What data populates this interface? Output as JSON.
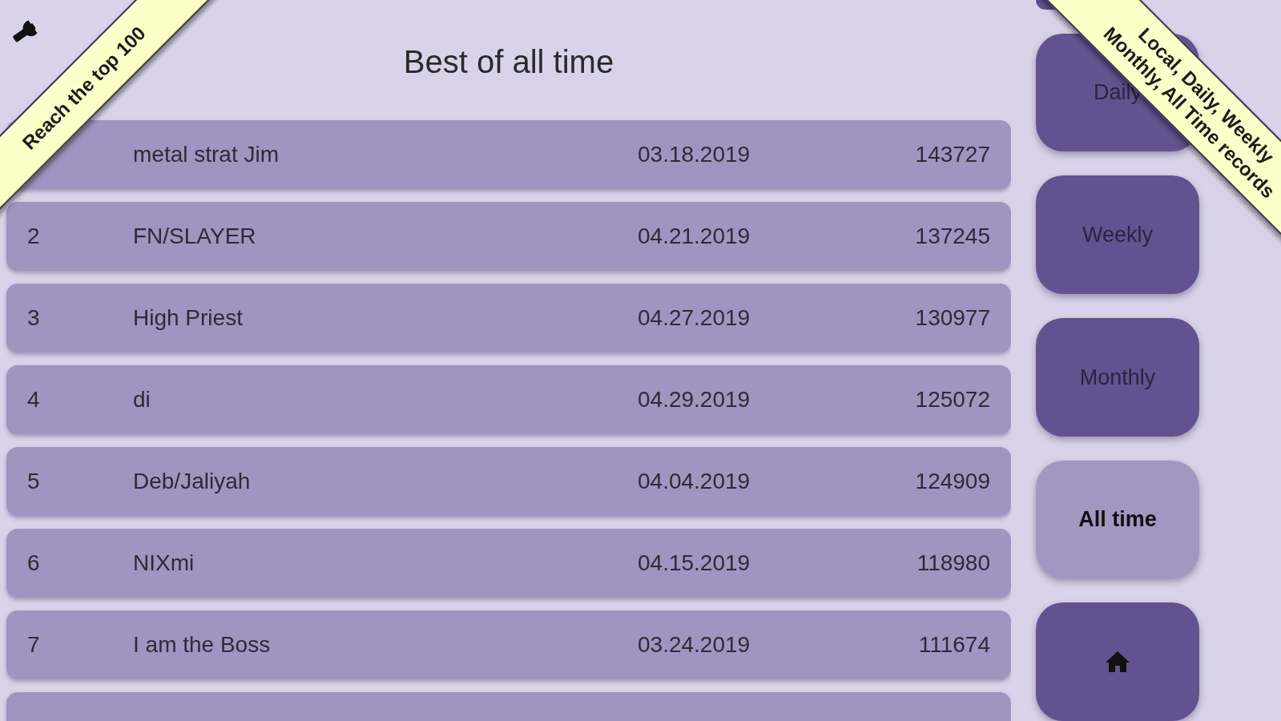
{
  "title": "Best of all time",
  "rows": [
    {
      "name": "metal strat Jim",
      "date": "03.18.2019",
      "score": "143727"
    },
    {
      "rank": "2",
      "name": "FN/SLAYER",
      "date": "04.21.2019",
      "score": "137245"
    },
    {
      "rank": "3",
      "name": "High Priest",
      "date": "04.27.2019",
      "score": "130977"
    },
    {
      "rank": "4",
      "name": "di",
      "date": "04.29.2019",
      "score": "125072"
    },
    {
      "rank": "5",
      "name": "Deb/Jaliyah",
      "date": "04.04.2019",
      "score": "124909"
    },
    {
      "rank": "6",
      "name": "NIXmi",
      "date": "04.15.2019",
      "score": "118980"
    },
    {
      "rank": "7",
      "name": "I am the Boss",
      "date": "03.24.2019",
      "score": "111674"
    },
    {}
  ],
  "buttons": [
    {
      "kind": "cut"
    },
    {
      "kind": "tab",
      "label": "Daily",
      "selected": false
    },
    {
      "kind": "tab",
      "label": "Weekly",
      "selected": false
    },
    {
      "kind": "tab",
      "label": "Monthly",
      "selected": false
    },
    {
      "kind": "tab",
      "label": "All time",
      "selected": true
    },
    {
      "kind": "home"
    }
  ],
  "ribbons": [
    {
      "kind": "left",
      "lines": [
        "Reach the top 100"
      ]
    },
    {
      "kind": "right",
      "lines": [
        "Local, Daily, Weekly",
        "Monthly, All Time records"
      ]
    }
  ]
}
